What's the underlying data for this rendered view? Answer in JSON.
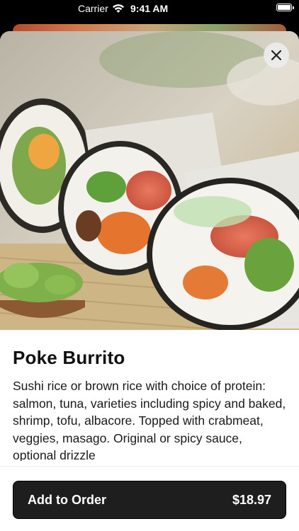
{
  "status_bar": {
    "carrier": "Carrier",
    "time": "9:41 AM"
  },
  "item": {
    "title": "Poke Burrito",
    "description": "Sushi rice or brown rice with choice of protein: salmon, tuna, varieties including spicy and baked, shrimp, tofu, albacore. Topped with crabmeat, veggies, masago. Original or spicy sauce, optional drizzle"
  },
  "order_button": {
    "label": "Add to Order",
    "price": "$18.97"
  },
  "icons": {
    "close": "close-icon",
    "wifi": "wifi-icon",
    "battery": "battery-icon"
  }
}
